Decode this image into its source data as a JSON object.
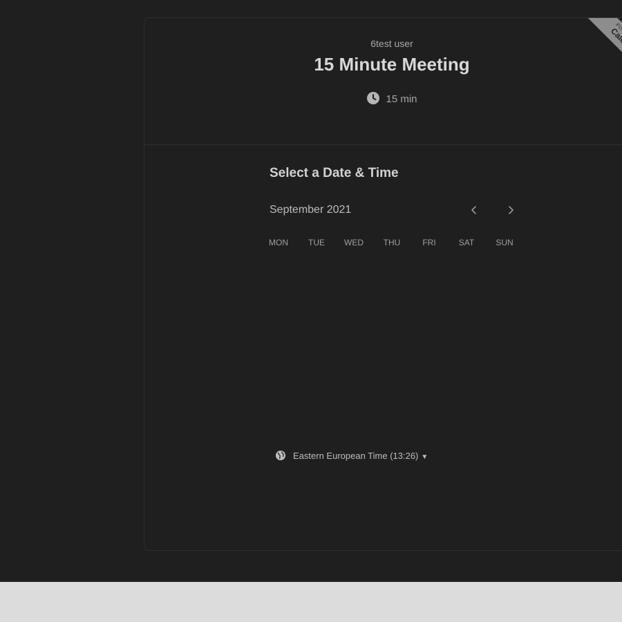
{
  "event": {
    "organizer": "6test user",
    "title": "15 Minute Meeting",
    "duration": "15 min"
  },
  "ribbon": {
    "powered_by": "POWERED BY",
    "brand": "Calendly"
  },
  "scheduler": {
    "heading": "Select a Date & Time",
    "month": "September 2021",
    "prev_icon": "chevron-left-icon",
    "next_icon": "chevron-right-icon",
    "weekdays": [
      "MON",
      "TUE",
      "WED",
      "THU",
      "FRI",
      "SAT",
      "SUN"
    ]
  },
  "timezone": {
    "label": "Eastern European Time (13:26)",
    "icon": "globe-icon"
  },
  "colors": {
    "background": "#1f1f1f",
    "text_primary": "#d8d8d8",
    "text_secondary": "#a8a8a8",
    "ribbon": "#8d8d8d",
    "bottom_strip": "#dcdcdc"
  }
}
